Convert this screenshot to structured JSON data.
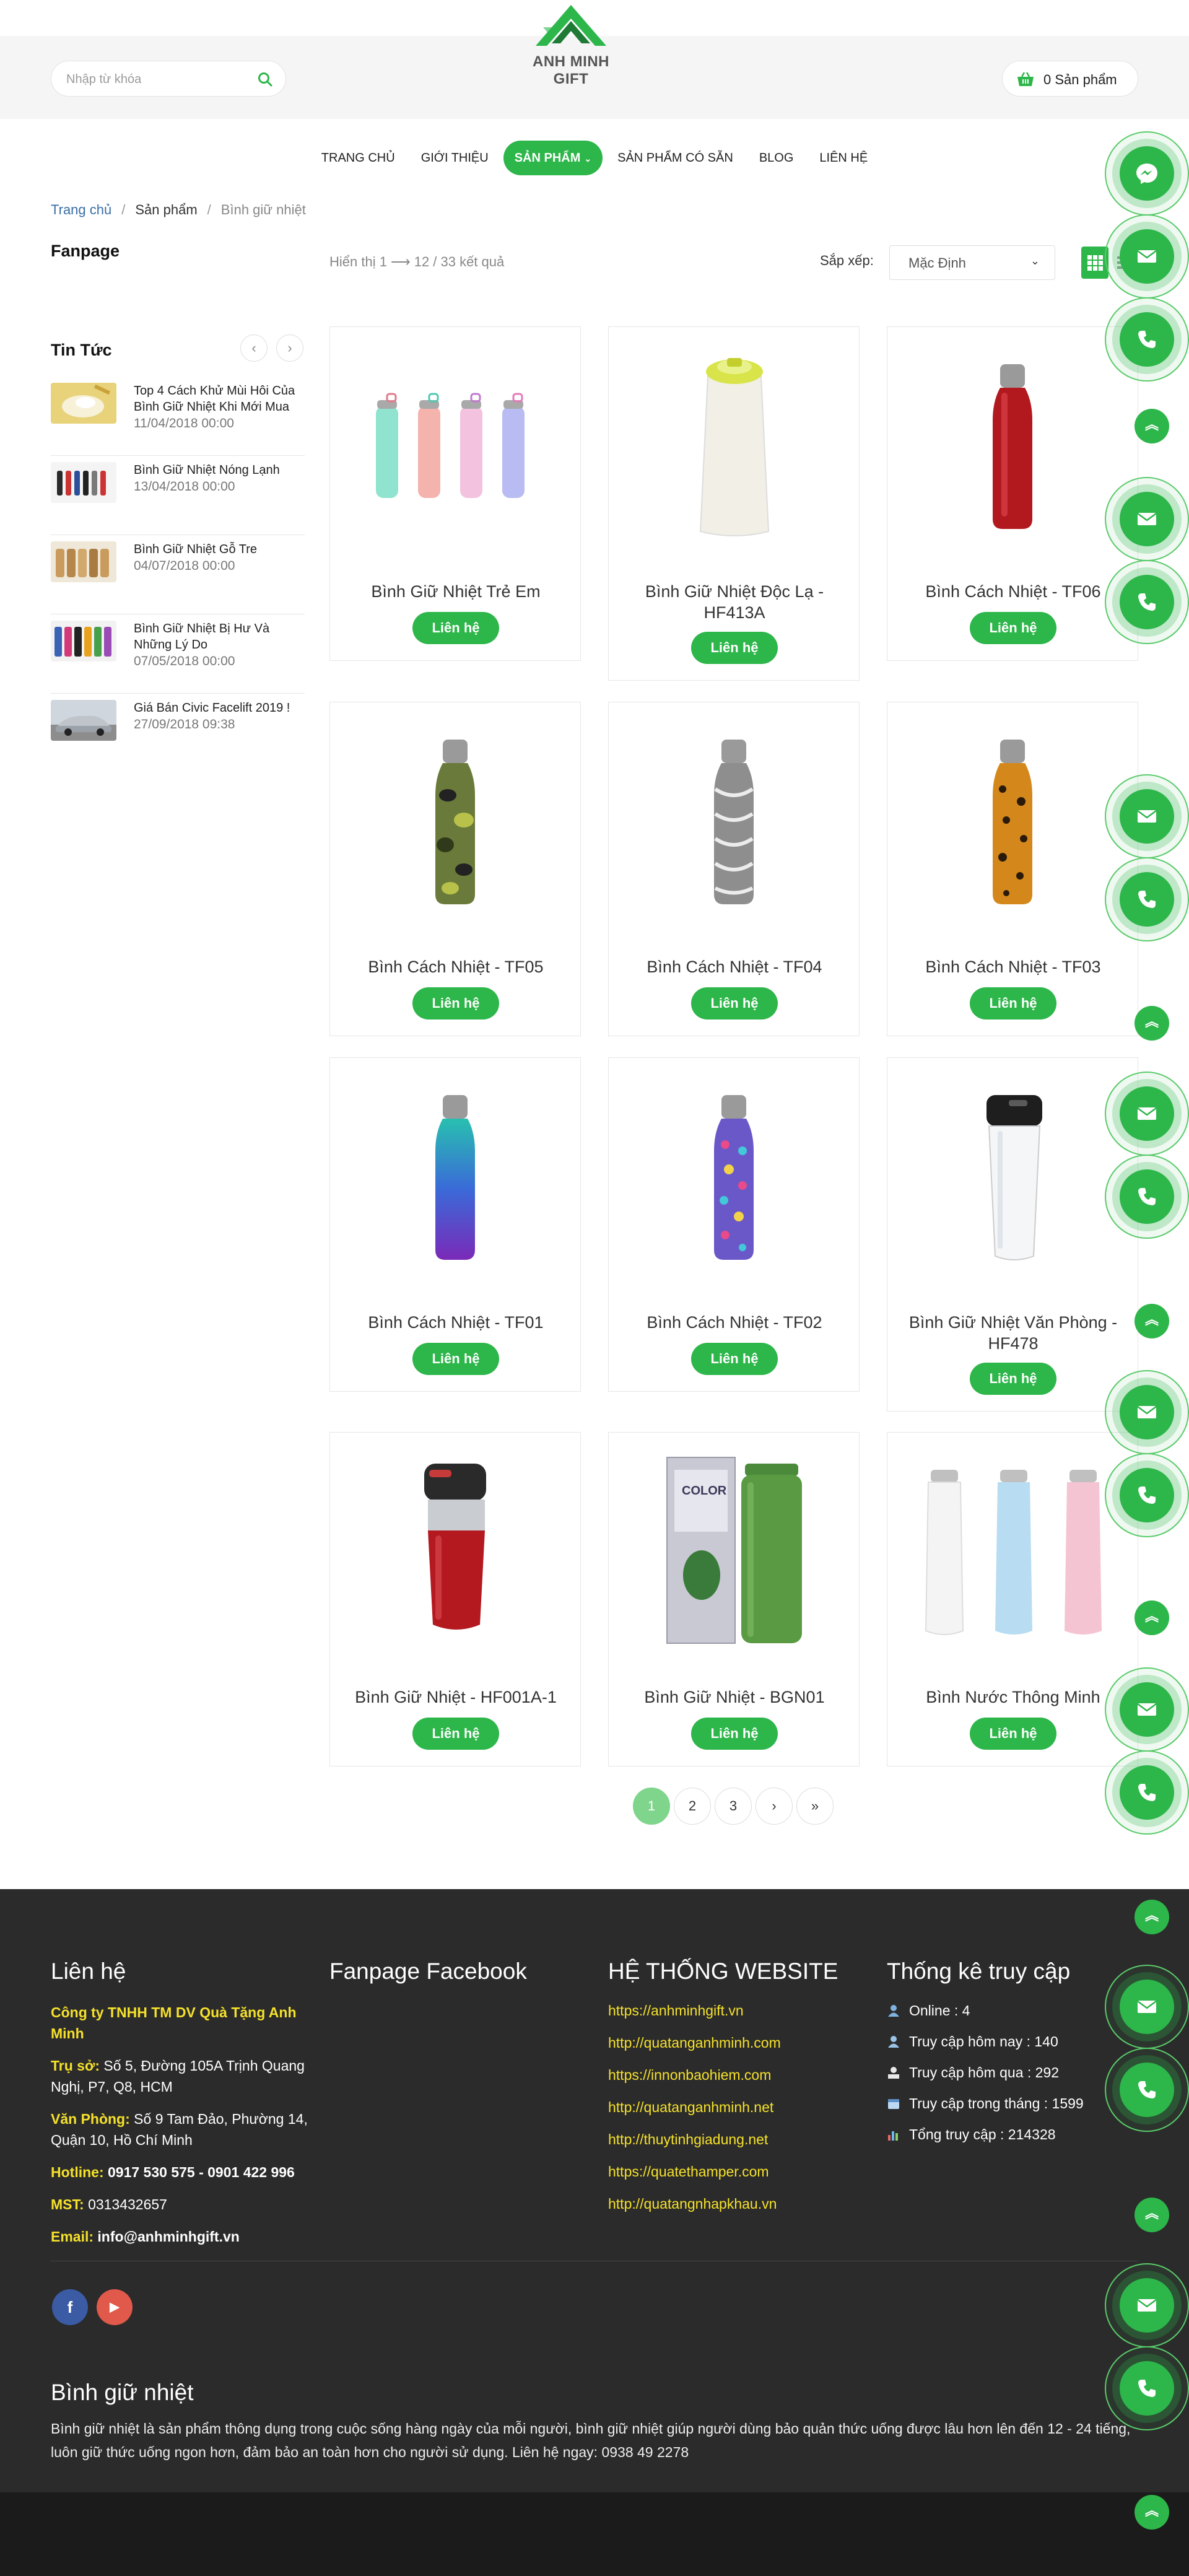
{
  "header": {
    "logo_text": "ANH MINH GIFT",
    "search_placeholder": "Nhập từ khóa",
    "cart_label": "0 Sản phẩm"
  },
  "nav": {
    "items": [
      {
        "label": "TRANG CHỦ"
      },
      {
        "label": "GIỚI THIỆU"
      },
      {
        "label": "SẢN PHẨM"
      },
      {
        "label": "SẢN PHẨM CÓ SẴN"
      },
      {
        "label": "BLOG"
      },
      {
        "label": "LIÊN HỆ"
      }
    ],
    "active_index": 2
  },
  "breadcrumb": {
    "home": "Trang chủ",
    "category": "Sản phẩm",
    "current": "Bình giữ nhiệt"
  },
  "sidebar": {
    "fanpage_title": "Fanpage",
    "news_title": "Tin Tức",
    "news": [
      {
        "title": "Top 4 Cách Khử Mùi Hôi Của Bình Giữ Nhiệt Khi Mới Mua",
        "date": "11/04/2018 00:00"
      },
      {
        "title": "Bình Giữ Nhiệt Nóng Lạnh",
        "date": "13/04/2018 00:00"
      },
      {
        "title": "Bình Giữ Nhiệt Gỗ Tre",
        "date": "04/07/2018 00:00"
      },
      {
        "title": "Bình Giữ Nhiệt Bị Hư Và Những Lý Do",
        "date": "07/05/2018 00:00"
      },
      {
        "title": "Giá Bán Civic Facelift 2019 !",
        "date": "27/09/2018 09:38"
      }
    ]
  },
  "toolbar": {
    "result_text": "Hiển thị 1 ⟶ 12 / 33 kết quả",
    "sort_label": "Sắp xếp:",
    "sort_value": "Mặc Định"
  },
  "products": [
    {
      "name": "Bình Giữ Nhiệt Trẻ Em",
      "button": "Liên hệ"
    },
    {
      "name": "Bình Giữ Nhiệt Độc Lạ - HF413A",
      "button": "Liên hệ"
    },
    {
      "name": "Bình Cách Nhiệt - TF06",
      "button": "Liên hệ"
    },
    {
      "name": "Bình Cách Nhiệt - TF05",
      "button": "Liên hệ"
    },
    {
      "name": "Bình Cách Nhiệt - TF04",
      "button": "Liên hệ"
    },
    {
      "name": "Bình Cách Nhiệt - TF03",
      "button": "Liên hệ"
    },
    {
      "name": "Bình Cách Nhiệt - TF01",
      "button": "Liên hệ"
    },
    {
      "name": "Bình Cách Nhiệt - TF02",
      "button": "Liên hệ"
    },
    {
      "name": "Bình Giữ Nhiệt Văn Phòng - HF478",
      "button": "Liên hệ"
    },
    {
      "name": "Bình Giữ Nhiệt - HF001A-1",
      "button": "Liên hệ"
    },
    {
      "name": "Bình Giữ Nhiệt - BGN01",
      "button": "Liên hệ"
    },
    {
      "name": "Bình Nước Thông Minh",
      "button": "Liên hệ"
    }
  ],
  "pagination": {
    "pages": [
      "1",
      "2",
      "3"
    ],
    "next": "›",
    "last": "»",
    "current": "1"
  },
  "footer": {
    "contact": {
      "title": "Liên hệ",
      "company": "Công ty TNHH TM DV Quà Tặng Anh Minh",
      "hq_label": "Trụ sở:",
      "hq_value": "Số 5, Đường 105A Trịnh Quang Nghị, P7, Q8, HCM",
      "office_label": "Văn Phòng:",
      "office_value": "Số 9 Tam Đảo, Phường 14, Quận 10, Hồ Chí Minh",
      "hotline_label": "Hotline:",
      "hotline_value": "0917 530 575 - 0901 422 996",
      "mst_label": "MST:",
      "mst_value": "0313432657",
      "email_label": "Email:",
      "email_value": "info@anhminhgift.vn"
    },
    "fanpage": {
      "title": "Fanpage Facebook"
    },
    "websites": {
      "title": "HỆ THỐNG WEBSITE",
      "links": [
        "https://anhminhgift.vn",
        "http://quatanganhminh.com",
        "https://innonbaohiem.com",
        "http://quatanganhminh.net",
        "http://thuytinhgiadung.net",
        "https://quatethamper.com",
        "http://quatangnhapkhau.vn"
      ]
    },
    "stats": {
      "title": "Thống kê truy cập",
      "items": [
        "Online : 4",
        "Truy cập hôm nay : 140",
        "Truy cập hôm qua : 292",
        "Truy cập trong tháng : 1599",
        "Tổng truy cập : 214328"
      ]
    },
    "social": {
      "facebook": "f",
      "youtube": "▶"
    },
    "description": {
      "title": "Bình giữ nhiệt",
      "text": "Bình giữ nhiệt là sản phẩm thông dụng trong cuộc sống hàng ngày của mỗi người, bình giữ nhiệt giúp người dùng bảo quản thức uống được lâu hơn lên đến 12 - 24 tiếng, luôn giữ thức uống ngon hơn, đảm bảo an toàn hơn cho người sử dụng. Liên hệ ngay: 0938 49 2278"
    }
  },
  "colors": {
    "brand_green": "#2db64a",
    "footer_bg": "#2b2b2b",
    "footer_highlight": "#f5e12b",
    "breadcrumb_link": "#3a6fa6"
  },
  "floating_icons": [
    "messenger-icon",
    "mail-icon",
    "phone-icon",
    "back-to-top-icon"
  ]
}
